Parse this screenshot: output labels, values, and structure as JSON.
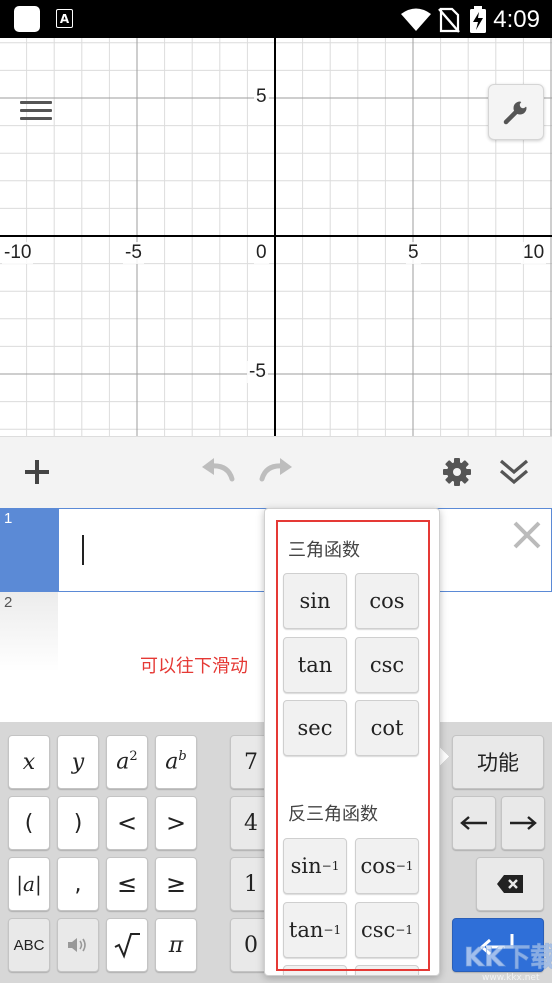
{
  "status_bar": {
    "time": "4:09",
    "icons": [
      "app-square-icon",
      "a-notification-icon",
      "wifi-icon",
      "no-sim-icon",
      "battery-charging-icon"
    ]
  },
  "graph": {
    "x_ticks": [
      "-10",
      "-5",
      "0",
      "5",
      "10"
    ],
    "y_ticks": [
      "5",
      "-5"
    ],
    "axis_color": "#000000",
    "grid_color": "#d9d9d9"
  },
  "toolbar": {
    "icons": [
      "add-icon",
      "undo-icon",
      "redo-icon",
      "gear-icon",
      "collapse-icon"
    ]
  },
  "expressions": [
    {
      "index": "1",
      "value": ""
    },
    {
      "index": "2",
      "value": ""
    }
  ],
  "hint": "可以往下滑动",
  "popup": {
    "section1_title": "三角函数",
    "section1_keys": [
      "sin",
      "cos",
      "tan",
      "csc",
      "sec",
      "cot"
    ],
    "section2_title": "反三角函数",
    "section2_keys": [
      {
        "base": "sin",
        "sup": "−1"
      },
      {
        "base": "cos",
        "sup": "−1"
      },
      {
        "base": "tan",
        "sup": "−1"
      },
      {
        "base": "csc",
        "sup": "−1"
      }
    ]
  },
  "keypad": {
    "keys": {
      "x": "x",
      "y": "y",
      "a2_base": "a",
      "a2_sup": "2",
      "ab_base": "a",
      "ab_sup": "b",
      "lparen": "(",
      "rparen": ")",
      "lt": "<",
      "gt": ">",
      "abs": "|a|",
      "comma": ",",
      "le": "≤",
      "ge": "≥",
      "abc": "ABC",
      "pi": "π",
      "n7": "7",
      "n4": "4",
      "n1": "1",
      "n0": "0",
      "functions": "功能"
    }
  },
  "colors": {
    "accent": "#5b8ad6",
    "enter": "#2f6fd8",
    "highlight": "#e53935"
  }
}
